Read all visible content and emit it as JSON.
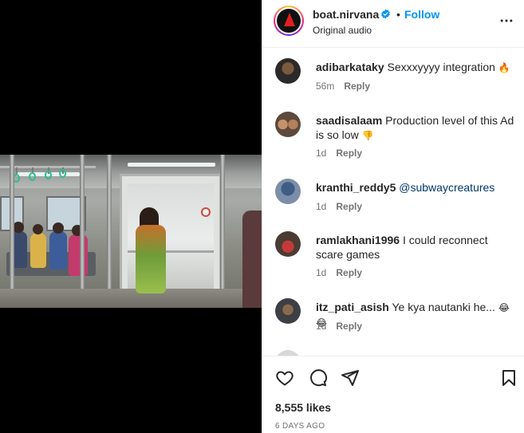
{
  "post": {
    "username": "boat.nirvana",
    "separator": "•",
    "follow_label": "Follow",
    "audio_label": "Original audio",
    "likes": "8,555 likes",
    "date": "6 DAYS AGO"
  },
  "comments": [
    {
      "user": "adibarkataky",
      "text": " Sexxxyyyy integration ",
      "emoji": "🔥",
      "time": "56m",
      "reply": "Reply"
    },
    {
      "user": "saadisalaam",
      "text": " Production level of this Ad is so low ",
      "emoji": "👎",
      "time": "1d",
      "reply": "Reply"
    },
    {
      "user": "kranthi_reddy5",
      "mention": " @subwaycreatures",
      "time": "1d",
      "reply": "Reply"
    },
    {
      "user": "ramlakhani1996",
      "text": " I could reconnect scare games",
      "time": "1d",
      "reply": "Reply"
    },
    {
      "user": "itz_pati_asish",
      "text": " Ye kya nautanki he... ",
      "emoji": "😂 😂",
      "time": "1d",
      "reply": "Reply"
    }
  ],
  "colors": {
    "accent": "#0095f6",
    "text": "#262626",
    "muted": "#737373",
    "verified": "#0095f6"
  },
  "icons": {
    "more": "more-horizontal-icon",
    "like": "heart-icon",
    "comment": "comment-icon",
    "share": "send-icon",
    "save": "bookmark-icon"
  }
}
